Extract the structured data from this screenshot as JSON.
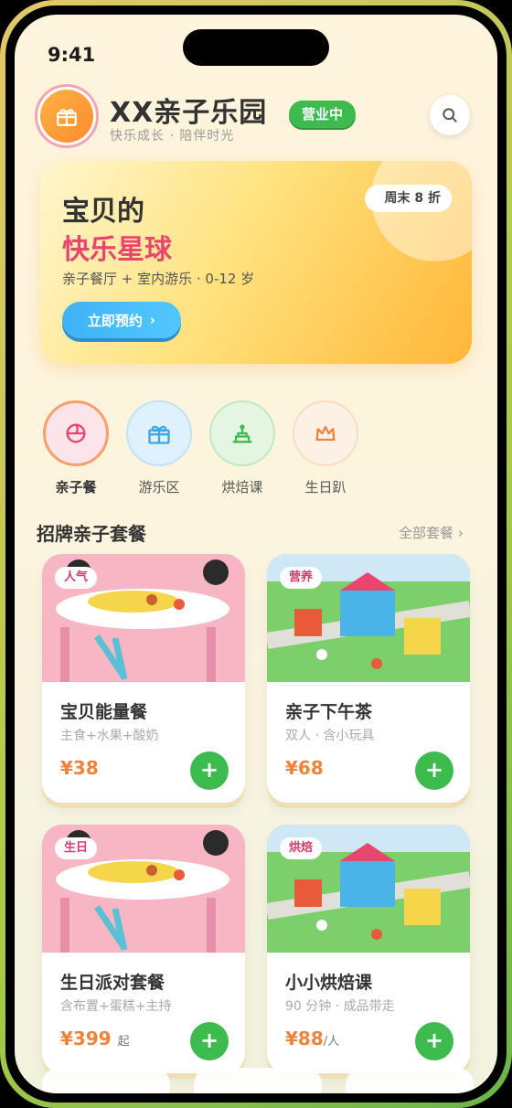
{
  "status_bar": {
    "time": "9:41"
  },
  "header": {
    "title": "XX亲子乐园",
    "subtitle": "快乐成长 · 陪伴时光",
    "status_badge": "营业中",
    "logo_icon": "gift-icon",
    "search_icon": "search-icon"
  },
  "banner": {
    "line1": "宝贝的",
    "line2": "快乐星球",
    "description": "亲子餐厅 + 室内游乐 · 0-12 岁",
    "button_label": "立即预约",
    "tag": "周末 8 折"
  },
  "categories": [
    {
      "label": "亲子餐",
      "icon": "bowl-icon",
      "color": "#e8456f",
      "bg": "#fde3ea"
    },
    {
      "label": "游乐区",
      "icon": "gift-icon",
      "color": "#3fa5e6",
      "bg": "#dff1fc"
    },
    {
      "label": "烘焙课",
      "icon": "cake-icon",
      "color": "#3dbb4f",
      "bg": "#e4f5e2"
    },
    {
      "label": "生日趴",
      "icon": "crown-icon",
      "color": "#f0833a",
      "bg": "#fdf0e4"
    }
  ],
  "section": {
    "title": "招牌亲子套餐",
    "more": "全部套餐 ›"
  },
  "products": [
    {
      "tag": "人气",
      "name": "宝贝能量餐",
      "desc": "主食+水果+酸奶",
      "price": "¥38",
      "unit": "",
      "image": "kids-dining"
    },
    {
      "tag": "营养",
      "name": "亲子下午茶",
      "desc": "双人 · 含小玩具",
      "price": "¥68",
      "unit": "",
      "image": "playground"
    },
    {
      "tag": "生日",
      "name": "生日派对套餐",
      "desc": "含布置+蛋糕+主持",
      "price": "¥399",
      "unit": "起",
      "image": "kids-dining"
    },
    {
      "tag": "烘焙",
      "name": "小小烘焙课",
      "desc": "90 分钟 · 成品带走",
      "price": "¥88",
      "unit": "/人",
      "image": "playground"
    }
  ],
  "colors": {
    "accent_green": "#3dbb4f",
    "accent_pink": "#e8456f",
    "accent_orange": "#f0833a",
    "accent_blue": "#3fb3f5"
  }
}
